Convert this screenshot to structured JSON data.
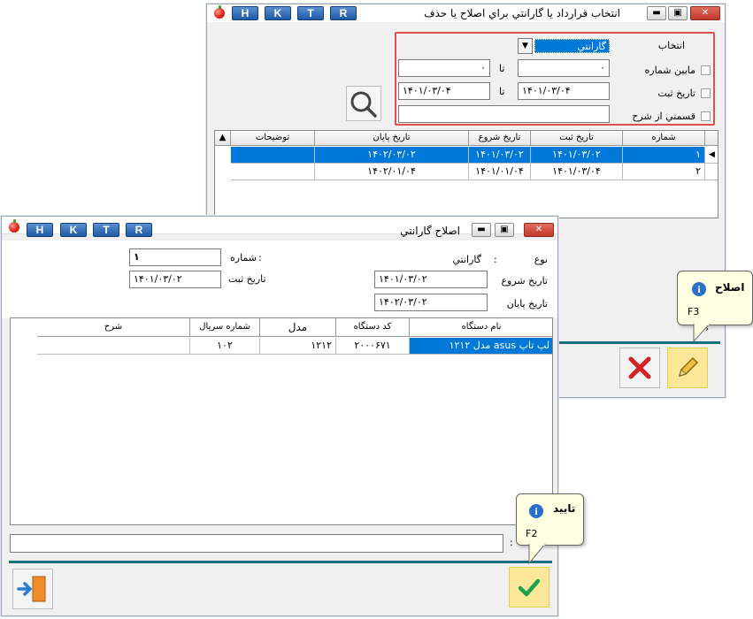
{
  "hotkeys": [
    "H",
    "K",
    "T",
    "R"
  ],
  "back_window": {
    "title": "انتخاب قرارداد يا گارانتي  براي اصلاح يا حذف",
    "filters": {
      "select_label": "انتخاب",
      "select_value": "گارانتي",
      "range_number_label": "مابين شماره",
      "from_number": "۰",
      "to_number": "۰",
      "date_label": "تاريخ ثبت",
      "from_date": "۱۴۰۱/۰۳/۰۴",
      "to_date": "۱۴۰۱/۰۳/۰۴",
      "to_word": "تا",
      "desc_part_label": "قسمتي از شرح",
      "desc_part_value": ""
    },
    "table": {
      "columns": [
        "شماره",
        "تاريخ ثبت",
        "تاريخ شروع",
        "تاريخ پايان",
        "توضيحات"
      ],
      "rows": [
        [
          "۱",
          "۱۴۰۱/۰۳/۰۲",
          "۱۴۰۱/۰۳/۰۲",
          "۱۴۰۲/۰۳/۰۲",
          ""
        ],
        [
          "۲",
          "۱۴۰۱/۰۳/۰۴",
          "۱۴۰۱/۰۱/۰۴",
          "۱۴۰۲/۰۱/۰۴",
          ""
        ]
      ]
    },
    "tooltip": {
      "title": "اصلاح",
      "shortcut": "F3"
    }
  },
  "front_window": {
    "title": "اصلاح گارانتي",
    "type_label": "نوع",
    "type_value": "گارانتي",
    "number_label": "شماره",
    "number_value": "۱",
    "reg_date_label": "تاريخ ثبت",
    "reg_date_value": "۱۴۰۱/۰۳/۰۲",
    "start_date_label": "تاريخ شروع",
    "start_date_value": "۱۴۰۱/۰۳/۰۲",
    "end_date_label": "تاريخ پايان",
    "end_date_value": "۱۴۰۲/۰۳/۰۲",
    "colon": ":",
    "table": {
      "columns": [
        "نام دستگاه",
        "کد دستگاه",
        "مدل",
        "شماره سريال",
        "شرح"
      ],
      "rows": [
        [
          "لپ تاپ asus مدل ۱۲۱۲",
          "۲۰۰۰۶۷۱",
          "۱۲۱۲",
          "۱۰۲",
          ""
        ]
      ]
    },
    "bottom_field": "",
    "tooltip": {
      "title": "تاييد",
      "shortcut": "F2"
    }
  }
}
